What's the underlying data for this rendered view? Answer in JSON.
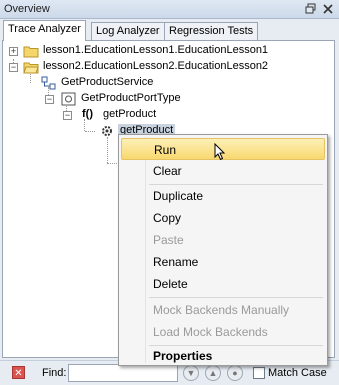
{
  "window": {
    "title": "Overview"
  },
  "tabs": [
    {
      "label": "Trace Analyzer",
      "active": true
    },
    {
      "label": "Log Analyzer",
      "active": false
    },
    {
      "label": "Regression Tests",
      "active": false
    }
  ],
  "tree": {
    "items": [
      {
        "label": "lesson1.EducationLesson1.EducationLesson1",
        "expander": "+"
      },
      {
        "label": "lesson2.EducationLesson2.EducationLesson2",
        "expander": "−"
      },
      {
        "label": "GetProductService",
        "expander": ""
      },
      {
        "label": "GetProductPortType",
        "expander": "−"
      },
      {
        "label": "getProduct",
        "expander": "−",
        "prefix": "f()"
      },
      {
        "label": "getProduct",
        "expander": "",
        "selected": true
      }
    ]
  },
  "context_menu": {
    "items": [
      {
        "label": "Run",
        "highlighted": true,
        "enabled": true
      },
      {
        "label": "Clear",
        "enabled": true
      },
      {
        "label": "Duplicate",
        "enabled": true
      },
      {
        "label": "Copy",
        "enabled": true
      },
      {
        "label": "Paste",
        "enabled": false
      },
      {
        "label": "Rename",
        "enabled": true
      },
      {
        "label": "Delete",
        "enabled": true
      },
      {
        "label": "Mock Backends Manually",
        "enabled": false
      },
      {
        "label": "Load Mock Backends",
        "enabled": false
      },
      {
        "label": "Properties",
        "enabled": true,
        "bold": true
      }
    ]
  },
  "find_bar": {
    "label": "Find:",
    "value": "",
    "match_case_label": "Match Case",
    "match_case_checked": false
  },
  "colors": {
    "menu_highlight": "#f8d86e",
    "selection": "#c9d3e0",
    "close_red": "#d9534f"
  }
}
